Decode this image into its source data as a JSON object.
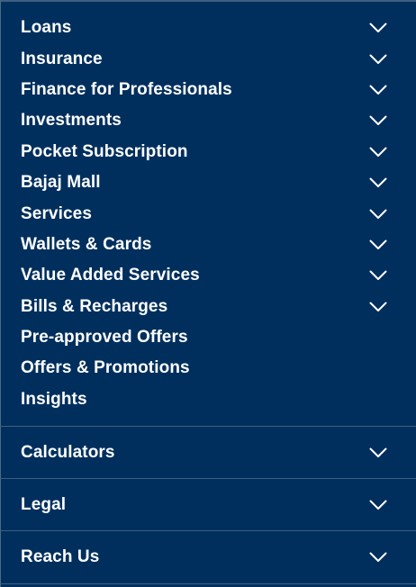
{
  "menu": {
    "items": [
      {
        "label": "Loans",
        "expandable": true
      },
      {
        "label": "Insurance",
        "expandable": true
      },
      {
        "label": "Finance for Professionals",
        "expandable": true
      },
      {
        "label": "Investments",
        "expandable": true
      },
      {
        "label": "Pocket Subscription",
        "expandable": true
      },
      {
        "label": "Bajaj Mall",
        "expandable": true
      },
      {
        "label": "Services",
        "expandable": true
      },
      {
        "label": "Wallets & Cards",
        "expandable": true
      },
      {
        "label": "Value Added Services",
        "expandable": true
      },
      {
        "label": "Bills & Recharges",
        "expandable": true
      },
      {
        "label": "Pre-approved Offers",
        "expandable": false
      },
      {
        "label": "Offers & Promotions",
        "expandable": false
      },
      {
        "label": "Insights",
        "expandable": false
      }
    ]
  },
  "sections": [
    {
      "label": "Calculators"
    },
    {
      "label": "Legal"
    },
    {
      "label": "Reach Us"
    }
  ],
  "colors": {
    "background": "#002f5d",
    "text": "#ffffff",
    "divider": "#3e5f7f"
  }
}
